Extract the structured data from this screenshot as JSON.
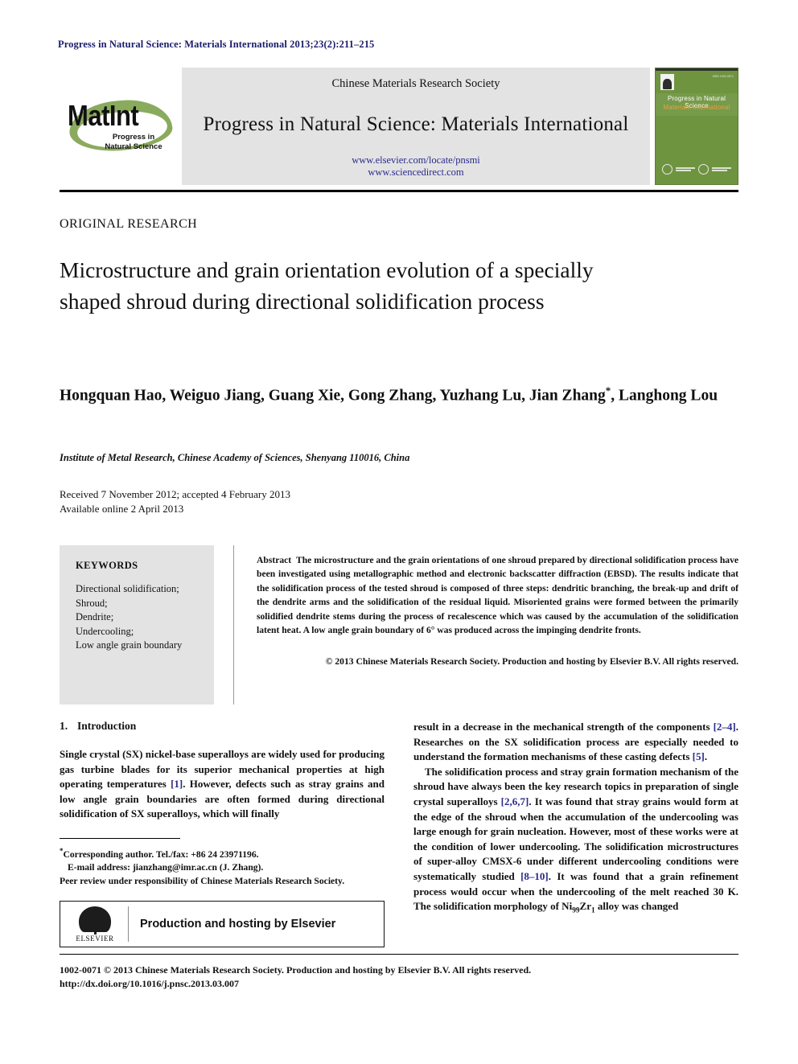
{
  "running_head": "Progress in Natural Science: Materials International 2013;23(2):211–215",
  "masthead": {
    "logo": {
      "wordmark": "MatInt",
      "subtitle": "Progress in\nNatural Science"
    },
    "society": "Chinese Materials Research Society",
    "journal_title": "Progress in Natural Science: Materials International",
    "link_elsevier": "www.elsevier.com/locate/pnsmi",
    "link_sciencedirect": "www.sciencedirect.com",
    "cover": {
      "issn": "ISSN 1002-0071",
      "title_line1": "Progress in Natural Science",
      "title_line2": "Materials International"
    }
  },
  "article": {
    "type_label": "ORIGINAL RESEARCH",
    "title": "Microstructure and grain orientation evolution of a specially shaped shroud during directional solidification process",
    "authors": "Hongquan Hao, Weiguo Jiang, Guang Xie, Gong Zhang, Yuzhang Lu, Jian Zhang",
    "authors_cont": ", Langhong Lou",
    "corresponding_marker": "*",
    "affiliation": "Institute of Metal Research, Chinese Academy of Sciences, Shenyang 110016, China",
    "received": "Received 7 November 2012; accepted 4 February 2013",
    "available": "Available online 2 April 2013"
  },
  "keywords": {
    "heading": "KEYWORDS",
    "items": [
      "Directional solidification;",
      "Shroud;",
      "Dendrite;",
      "Undercooling;",
      "Low angle grain boundary"
    ]
  },
  "abstract": {
    "label": "Abstract",
    "text": "The microstructure and the grain orientations of one shroud prepared by directional solidification process have been investigated using metallographic method and electronic backscatter diffraction (EBSD). The results indicate that the solidification process of the tested shroud is composed of three steps: dendritic branching, the break-up and drift of the dendrite arms and the solidification of the residual liquid. Misoriented grains were formed between the primarily solidified dendrite stems during the process of recalescence which was caused by the accumulation of the solidification latent heat. A low angle grain boundary of 6° was produced across the impinging dendrite fronts.",
    "copyright": "© 2013 Chinese Materials Research Society. Production and hosting by Elsevier B.V. All rights reserved."
  },
  "body": {
    "section_number": "1.",
    "section_title": "Introduction",
    "left_para1_a": "Single crystal (SX) nickel-base superalloys are widely used for producing gas turbine blades for its superior mechanical properties at high operating temperatures ",
    "left_ref1": "[1]",
    "left_para1_b": ". However, defects such as stray grains and low angle grain boundaries are often formed during directional solidification of SX superalloys, which will finally",
    "right_para1_a": "result in a decrease in the mechanical strength of the components ",
    "right_ref1": "[2–4]",
    "right_para1_b": ". Researches on the SX solidification process are especially needed to understand the formation mechanisms of these casting defects ",
    "right_ref2": "[5]",
    "right_para1_c": ".",
    "right_para2_a": "The solidification process and stray grain formation mechanism of the shroud have always been the key research topics in preparation of single crystal superalloys ",
    "right_ref3": "[2,6,7]",
    "right_para2_b": ". It was found that stray grains would form at the edge of the shroud when the accumulation of the undercooling was large enough for grain nucleation. However, most of these works were at the condition of lower undercooling. The solidification microstructures of super-alloy CMSX-6 under different undercooling conditions were systematically studied ",
    "right_ref4": "[8–10]",
    "right_para2_c": ". It was found that a grain refinement process would occur when the undercooling of the melt reached 30 K. The solidification morphology of Ni",
    "right_sub1": "99",
    "right_para2_d": "Zr",
    "right_sub2": "1",
    "right_para2_e": " alloy was changed"
  },
  "footnote": {
    "corresponding": "Corresponding author. Tel./fax: +86 24 23971196.",
    "email": "E-mail address: jianzhang@imr.ac.cn (J. Zhang).",
    "peer_review": "Peer review under responsibility of Chinese Materials Research Society."
  },
  "elsevier_box": {
    "logo_word": "ELSEVIER",
    "label": "Production and hosting by Elsevier"
  },
  "footer": {
    "line1": "1002-0071 © 2013 Chinese Materials Research Society. Production and hosting by Elsevier B.V. All rights reserved.",
    "line2": "http://dx.doi.org/10.1016/j.pnsc.2013.03.007"
  },
  "colors": {
    "header_blue": "#1b1b6b",
    "link_blue": "#2a2a8c",
    "panel_gray": "#e3e3e3",
    "cover_green": "#6f9440",
    "logo_green": "#8aab5d",
    "cover_orange": "#e8a33d"
  }
}
